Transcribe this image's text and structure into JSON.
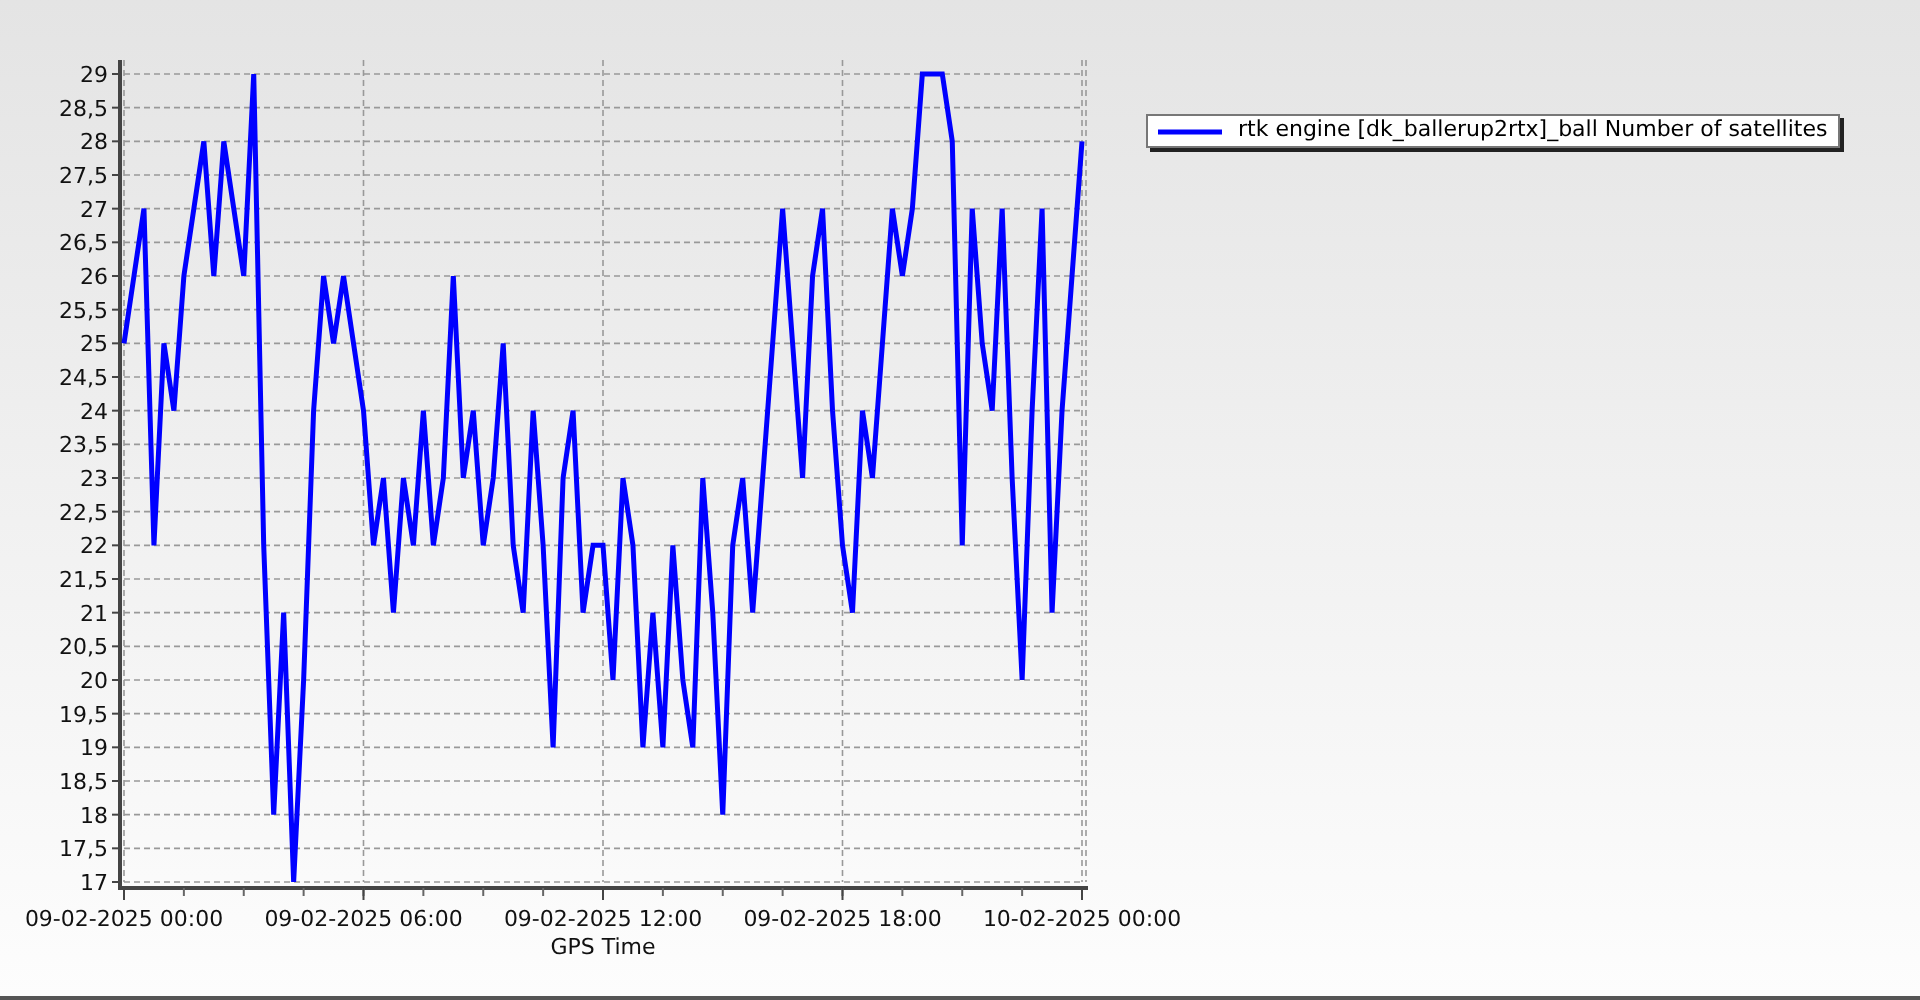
{
  "chart": {
    "chart_data": {
      "type": "line",
      "grid": true,
      "xlabel": "GPS Time",
      "categories": [
        "09-02-2025 00:00",
        null,
        null,
        null,
        null,
        null,
        null,
        null,
        null,
        null,
        null,
        null,
        null,
        null,
        null,
        null,
        null,
        null,
        null,
        null,
        null,
        null,
        null,
        null,
        "09-02-2025 06:00",
        null,
        null,
        null,
        null,
        null,
        null,
        null,
        null,
        null,
        null,
        null,
        null,
        null,
        null,
        null,
        null,
        null,
        null,
        null,
        null,
        null,
        null,
        null,
        "09-02-2025 12:00",
        null,
        null,
        null,
        null,
        null,
        null,
        null,
        null,
        null,
        null,
        null,
        null,
        null,
        null,
        null,
        null,
        null,
        null,
        null,
        null,
        null,
        null,
        null,
        "09-02-2025 18:00",
        null,
        null,
        null,
        null,
        null,
        null,
        null,
        null,
        null,
        null,
        null,
        null,
        null,
        null,
        null,
        null,
        null,
        null,
        null,
        null,
        null,
        null,
        null,
        "10-02-2025 00:00"
      ],
      "series": [
        {
          "name": "rtk engine [dk_ballerup2rtx]_ball Number of satellites",
          "color": "#0000ff",
          "values": [
            25,
            26,
            27,
            22,
            25,
            24,
            26,
            27,
            28,
            26,
            28,
            27,
            26,
            29,
            22,
            18,
            21,
            17,
            20,
            24,
            26,
            25,
            26,
            25,
            24,
            22,
            23,
            21,
            23,
            22,
            24,
            22,
            23,
            26,
            23,
            24,
            22,
            23,
            25,
            22,
            21,
            24,
            22,
            19,
            23,
            24,
            21,
            22,
            22,
            20,
            23,
            22,
            19,
            21,
            19,
            22,
            20,
            19,
            23,
            21,
            18,
            22,
            23,
            21,
            23,
            25,
            27,
            25,
            23,
            26,
            27,
            24,
            22,
            21,
            24,
            23,
            25,
            27,
            26,
            27,
            29,
            29,
            29,
            28,
            22,
            27,
            25,
            24,
            27,
            23,
            20,
            24,
            27,
            21,
            24,
            26,
            28
          ]
        }
      ],
      "ylim": [
        17,
        29
      ],
      "yticks": [
        17,
        {
          "value": 17.5,
          "label": "17,5"
        },
        18,
        {
          "value": 18.5,
          "label": "18,5"
        },
        19,
        {
          "value": 19.5,
          "label": "19,5"
        },
        20,
        {
          "value": 20.5,
          "label": "20,5"
        },
        21,
        {
          "value": 21.5,
          "label": "21,5"
        },
        22,
        {
          "value": 22.5,
          "label": "22,5"
        },
        23,
        {
          "value": 23.5,
          "label": "23,5"
        },
        24,
        {
          "value": 24.5,
          "label": "24,5"
        },
        25,
        {
          "value": 25.5,
          "label": "25,5"
        },
        26,
        {
          "value": 26.5,
          "label": "26,5"
        },
        27,
        {
          "value": 27.5,
          "label": "27,5"
        },
        28,
        {
          "value": 28.5,
          "label": "28,5"
        },
        29
      ]
    }
  }
}
